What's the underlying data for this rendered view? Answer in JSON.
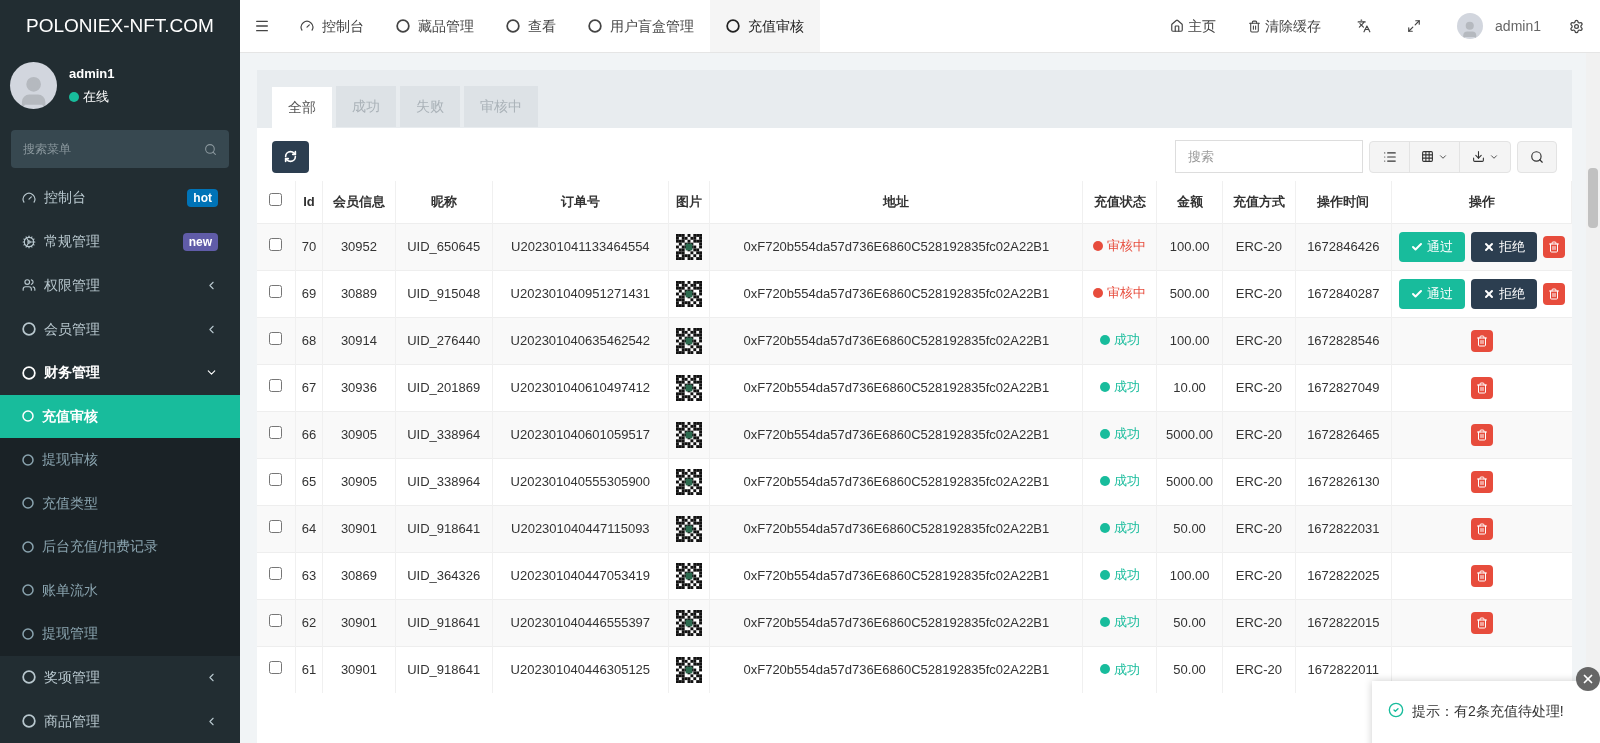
{
  "brand": "POLONIEX-NFT.COM",
  "user": {
    "name": "admin1",
    "status": "在线"
  },
  "sidebar": {
    "search_placeholder": "搜索菜单",
    "items": [
      {
        "label": "控制台",
        "kind": "dashboard",
        "badge": {
          "text": "hot",
          "color": "#0073b7"
        },
        "expanded": false,
        "selected": false
      },
      {
        "label": "常规管理",
        "kind": "cogs",
        "badge": {
          "text": "new",
          "color": "#605ca8"
        },
        "expanded": false,
        "selected": false
      },
      {
        "label": "权限管理",
        "kind": "users",
        "expanded": false,
        "selected": false,
        "has_children": true
      },
      {
        "label": "会员管理",
        "kind": "circle",
        "expanded": false,
        "selected": false,
        "has_children": true
      },
      {
        "label": "财务管理",
        "kind": "circle",
        "expanded": true,
        "selected": false,
        "has_children": true,
        "children": [
          {
            "label": "充值审核",
            "selected": true
          },
          {
            "label": "提现审核",
            "selected": false
          },
          {
            "label": "充值类型",
            "selected": false
          },
          {
            "label": "后台充值/扣费记录",
            "selected": false
          },
          {
            "label": "账单流水",
            "selected": false
          },
          {
            "label": "提现管理",
            "selected": false
          }
        ]
      },
      {
        "label": "奖项管理",
        "kind": "circle",
        "expanded": false,
        "selected": false,
        "has_children": true
      },
      {
        "label": "商品管理",
        "kind": "circle",
        "expanded": false,
        "selected": false,
        "has_children": true
      }
    ]
  },
  "top_tabs": [
    {
      "label": "控制台",
      "kind": "dashboard",
      "selected": false
    },
    {
      "label": "藏品管理",
      "kind": "circle",
      "selected": false
    },
    {
      "label": "查看",
      "kind": "circle",
      "selected": false
    },
    {
      "label": "用户盲盒管理",
      "kind": "circle",
      "selected": false
    },
    {
      "label": "充值审核",
      "kind": "circle",
      "selected": true
    }
  ],
  "top_right": {
    "home": "主页",
    "clear_cache": "清除缓存",
    "user": "admin1"
  },
  "filter_tabs": [
    {
      "label": "全部",
      "selected": true
    },
    {
      "label": "成功",
      "selected": false
    },
    {
      "label": "失败",
      "selected": false
    },
    {
      "label": "审核中",
      "selected": false
    }
  ],
  "search": {
    "placeholder": "搜索"
  },
  "table": {
    "all_checked": false,
    "columns": [
      "Id",
      "会员信息",
      "昵称",
      "订单号",
      "图片",
      "地址",
      "充值状态",
      "金额",
      "充值方式",
      "操作时间",
      "操作"
    ],
    "rows": [
      {
        "checked": false,
        "cells": [
          "70",
          "30952",
          "UID_650645",
          "U202301041133464554",
          "0xF720b554da57d736E6860C528192835fc02A22B1"
        ],
        "status": {
          "text": "审核中",
          "kind": "pending"
        },
        "amount": "100.00",
        "method": "ERC-20",
        "time": "1672846426",
        "actions": [
          {
            "kind": "approve",
            "label": "通过"
          },
          {
            "kind": "reject",
            "label": "拒绝"
          },
          {
            "kind": "delete"
          }
        ]
      },
      {
        "checked": false,
        "cells": [
          "69",
          "30889",
          "UID_915048",
          "U202301040951271431",
          "0xF720b554da57d736E6860C528192835fc02A22B1"
        ],
        "status": {
          "text": "审核中",
          "kind": "pending"
        },
        "amount": "500.00",
        "method": "ERC-20",
        "time": "1672840287",
        "actions": [
          {
            "kind": "approve",
            "label": "通过"
          },
          {
            "kind": "reject",
            "label": "拒绝"
          },
          {
            "kind": "delete"
          }
        ]
      },
      {
        "checked": false,
        "cells": [
          "68",
          "30914",
          "UID_276440",
          "U202301040635462542",
          "0xF720b554da57d736E6860C528192835fc02A22B1"
        ],
        "status": {
          "text": "成功",
          "kind": "success"
        },
        "amount": "100.00",
        "method": "ERC-20",
        "time": "1672828546",
        "actions": [
          {
            "kind": "delete"
          }
        ]
      },
      {
        "checked": false,
        "cells": [
          "67",
          "30936",
          "UID_201869",
          "U202301040610497412",
          "0xF720b554da57d736E6860C528192835fc02A22B1"
        ],
        "status": {
          "text": "成功",
          "kind": "success"
        },
        "amount": "10.00",
        "method": "ERC-20",
        "time": "1672827049",
        "actions": [
          {
            "kind": "delete"
          }
        ]
      },
      {
        "checked": false,
        "cells": [
          "66",
          "30905",
          "UID_338964",
          "U202301040601059517",
          "0xF720b554da57d736E6860C528192835fc02A22B1"
        ],
        "status": {
          "text": "成功",
          "kind": "success"
        },
        "amount": "5000.00",
        "method": "ERC-20",
        "time": "1672826465",
        "actions": [
          {
            "kind": "delete"
          }
        ]
      },
      {
        "checked": false,
        "cells": [
          "65",
          "30905",
          "UID_338964",
          "U202301040555305900",
          "0xF720b554da57d736E6860C528192835fc02A22B1"
        ],
        "status": {
          "text": "成功",
          "kind": "success"
        },
        "amount": "5000.00",
        "method": "ERC-20",
        "time": "1672826130",
        "actions": [
          {
            "kind": "delete"
          }
        ]
      },
      {
        "checked": false,
        "cells": [
          "64",
          "30901",
          "UID_918641",
          "U202301040447115093",
          "0xF720b554da57d736E6860C528192835fc02A22B1"
        ],
        "status": {
          "text": "成功",
          "kind": "success"
        },
        "amount": "50.00",
        "method": "ERC-20",
        "time": "1672822031",
        "actions": [
          {
            "kind": "delete"
          }
        ]
      },
      {
        "checked": false,
        "cells": [
          "63",
          "30869",
          "UID_364326",
          "U202301040447053419",
          "0xF720b554da57d736E6860C528192835fc02A22B1"
        ],
        "status": {
          "text": "成功",
          "kind": "success"
        },
        "amount": "100.00",
        "method": "ERC-20",
        "time": "1672822025",
        "actions": [
          {
            "kind": "delete"
          }
        ]
      },
      {
        "checked": false,
        "cells": [
          "62",
          "30901",
          "UID_918641",
          "U202301040446555397",
          "0xF720b554da57d736E6860C528192835fc02A22B1"
        ],
        "status": {
          "text": "成功",
          "kind": "success"
        },
        "amount": "50.00",
        "method": "ERC-20",
        "time": "1672822015",
        "actions": [
          {
            "kind": "delete"
          }
        ]
      },
      {
        "checked": false,
        "cells": [
          "61",
          "30901",
          "UID_918641",
          "U202301040446305125",
          "0xF720b554da57d736E6860C528192835fc02A22B1"
        ],
        "status": {
          "text": "成功",
          "kind": "success"
        },
        "amount": "50.00",
        "method": "ERC-20",
        "time": "1672822011",
        "actions": []
      }
    ]
  },
  "toast": {
    "text": "提示：有2条充值待处理!"
  }
}
